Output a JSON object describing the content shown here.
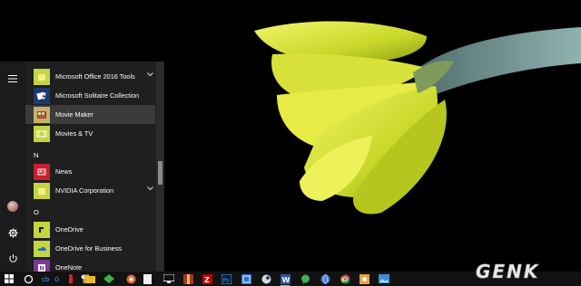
{
  "start_menu": {
    "rail": {
      "menu_icon": "hamburger-icon",
      "user_icon": "user-avatar",
      "settings_icon": "gear-icon",
      "power_icon": "power-icon"
    },
    "apps": [
      {
        "label": "Microsoft Office 2016 Tools",
        "tile_color": "#c5d542",
        "expandable": true
      },
      {
        "label": "Microsoft Solitaire Collection",
        "tile_color": "#1d3a6e",
        "icon": "solitaire-icon"
      },
      {
        "label": "Movie Maker",
        "tile_color": "#c9b070",
        "icon": "movie-maker-icon",
        "selected": true
      },
      {
        "label": "Movies & TV",
        "tile_color": "#c5d542",
        "icon": "movies-tv-icon"
      },
      {
        "label": "News",
        "tile_color": "#c8202f",
        "icon": "news-icon"
      },
      {
        "label": "NVIDIA Corporation",
        "tile_color": "#c5d542",
        "expandable": true
      },
      {
        "label": "OneDrive",
        "tile_color": "#c5d542",
        "icon": "onedrive-icon"
      },
      {
        "label": "OneDrive for Business",
        "tile_color": "#c5d542",
        "icon": "onedrive-business-icon"
      },
      {
        "label": "OneNote",
        "tile_color": "#7a3a96",
        "icon": "onenote-icon"
      }
    ],
    "letters": {
      "n": "N",
      "o": "O"
    }
  },
  "taskbar": {
    "items": [
      "windows-start-icon",
      "cortana-search-icon",
      "cdn-app-icon",
      "gf-app-icon",
      "red-figure-icon",
      "pin-app-icon",
      "folder-icon",
      "green-app-icon",
      "edge-app-icon",
      "blank-doc-icon",
      "monitor-icon",
      "zip-icon",
      "filezilla-icon",
      "photoshop-icon",
      "settings-app-icon",
      "steam-icon",
      "word-icon",
      "chat-icon",
      "globe-icon",
      "chrome-icon",
      "paint-icon",
      "photo-viewer-icon"
    ]
  },
  "watermark": {
    "text": "GENK"
  }
}
